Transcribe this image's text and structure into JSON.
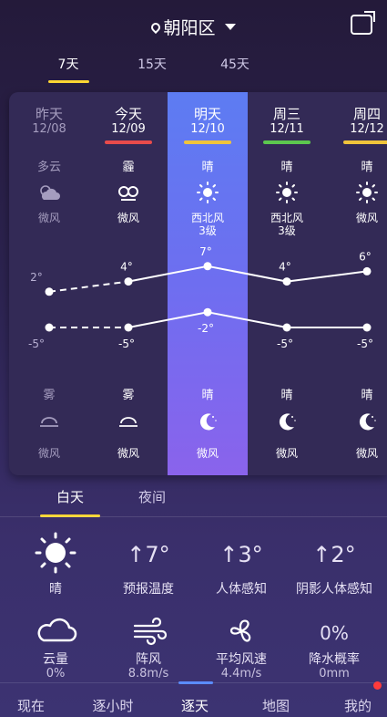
{
  "header": {
    "location": "朝阳区"
  },
  "range_tabs": [
    "7天",
    "15天",
    "45天"
  ],
  "days": [
    {
      "day": "昨天",
      "date": "12/08",
      "day_cond": "多云",
      "day_wind": "微风",
      "day_wind2": "",
      "night_cond": "雾",
      "night_wind": "微风",
      "line_color": "",
      "muted": true,
      "day_icon": "partly-cloudy-icon",
      "night_icon": "fog-icon"
    },
    {
      "day": "今天",
      "date": "12/09",
      "day_cond": "霾",
      "day_wind": "微风",
      "day_wind2": "",
      "night_cond": "雾",
      "night_wind": "微风",
      "line_color": "#e84b4b",
      "muted": false,
      "day_icon": "haze-icon",
      "night_icon": "fog-icon"
    },
    {
      "day": "明天",
      "date": "12/10",
      "day_cond": "晴",
      "day_wind": "西北风",
      "day_wind2": "3级",
      "night_cond": "晴",
      "night_wind": "微风",
      "line_color": "#f0c43b",
      "muted": false,
      "day_icon": "sun-icon",
      "night_icon": "moon-icon"
    },
    {
      "day": "周三",
      "date": "12/11",
      "day_cond": "晴",
      "day_wind": "西北风",
      "day_wind2": "3级",
      "night_cond": "晴",
      "night_wind": "微风",
      "line_color": "#5cc74e",
      "muted": false,
      "day_icon": "sun-icon",
      "night_icon": "moon-icon"
    },
    {
      "day": "周四",
      "date": "12/12",
      "day_cond": "晴",
      "day_wind": "微风",
      "day_wind2": "",
      "night_cond": "晴",
      "night_wind": "微风",
      "line_color": "#f0c43b",
      "muted": false,
      "day_icon": "sun-icon",
      "night_icon": "moon-icon"
    }
  ],
  "temps": {
    "high": [
      2,
      4,
      7,
      4,
      6
    ],
    "low": [
      -5,
      -5,
      -2,
      -5,
      -5
    ],
    "high_labels": [
      "2°",
      "4°",
      "7°",
      "4°",
      "6°"
    ],
    "low_labels": [
      "-5°",
      "-5°",
      "-2°",
      "-5°",
      "-5°"
    ]
  },
  "day_night_tabs": [
    "白天",
    "夜间"
  ],
  "details": {
    "weather": "晴",
    "forecast_temp": "↑7°",
    "forecast_temp_label": "预报温度",
    "feels_like": "↑3°",
    "feels_like_label": "人体感知",
    "shade_feels": "↑2°",
    "shade_feels_label": "阴影人体感知",
    "cloud_label": "云量",
    "cloud_value": "0%",
    "gust_label": "阵风",
    "gust_value": "8.8m/s",
    "wind_label": "平均风速",
    "wind_value": "4.4m/s",
    "precip_big": "0%",
    "precip_label": "降水概率",
    "precip_value": "0mm"
  },
  "bottom_nav": [
    "现在",
    "逐小时",
    "逐天",
    "地图",
    "我的"
  ],
  "colors": {
    "accent_yellow": "#ffd633",
    "highlight_blue": "#5d7cf2",
    "nav_indicator": "#5b8cff",
    "badge_red": "#ff3b3b"
  }
}
